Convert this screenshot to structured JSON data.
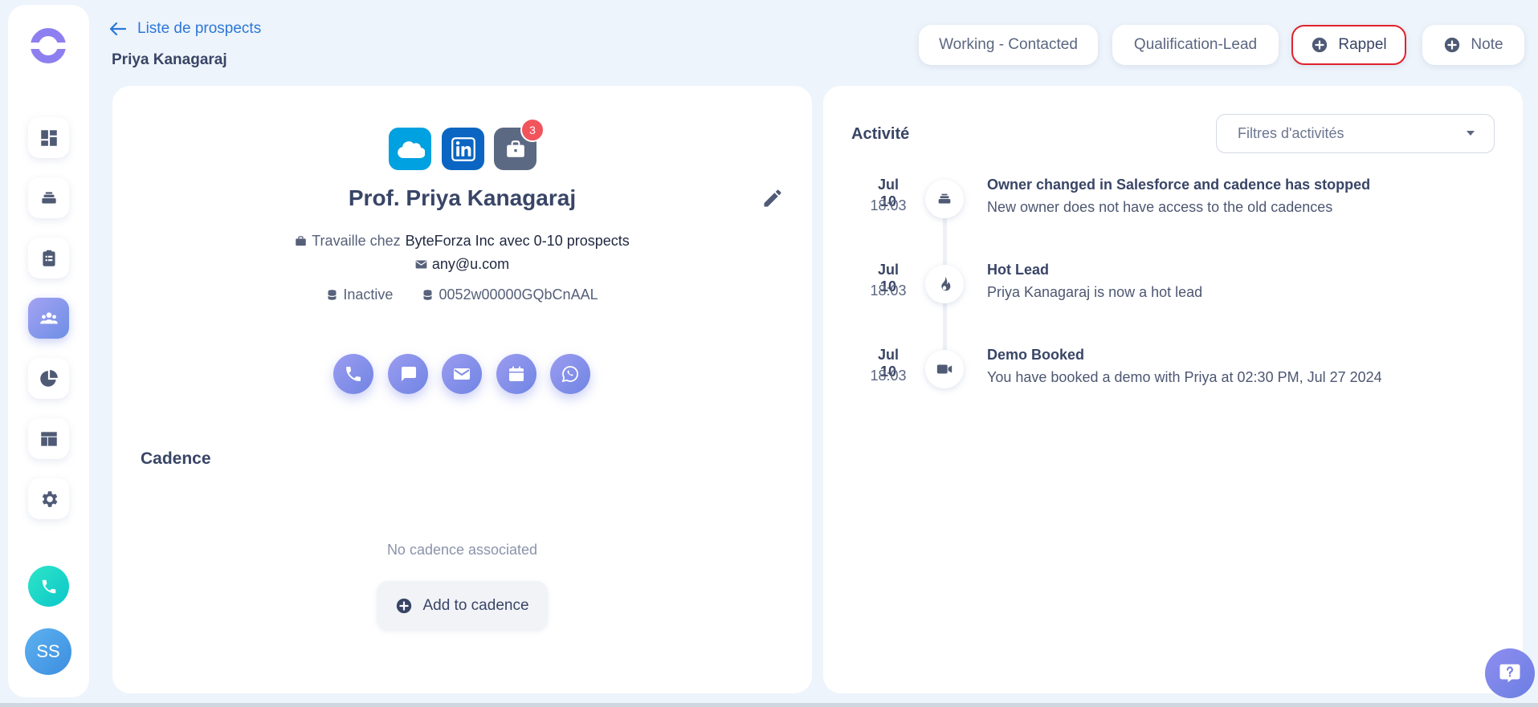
{
  "header": {
    "back_label": "Liste de prospects",
    "page_title": "Priya Kanagaraj",
    "status_button": "Working - Contacted",
    "stage_button": "Qualification-Lead",
    "reminder_button": "Rappel",
    "note_button": "Note"
  },
  "sidebar": {
    "items": [
      {
        "name": "dashboard"
      },
      {
        "name": "layers"
      },
      {
        "name": "tasks"
      },
      {
        "name": "leads",
        "active": true
      },
      {
        "name": "reports"
      },
      {
        "name": "templates"
      },
      {
        "name": "settings"
      }
    ],
    "avatar_initials": "SS"
  },
  "lead": {
    "name": "Prof. Priya Kanagaraj",
    "integration_badge_count": "3",
    "works_at_prefix": "Travaille chez",
    "company": "ByteForza Inc",
    "company_size": "avec 0-10 prospects",
    "email": "any@u.com",
    "status": "Inactive",
    "salesforce_id": "0052w00000GQbCnAAL"
  },
  "cadence": {
    "title": "Cadence",
    "empty_text": "No cadence associated",
    "add_button": "Add to cadence"
  },
  "activity": {
    "title": "Activité",
    "filter_placeholder": "Filtres d'activités",
    "items": [
      {
        "date": "Jul 10",
        "time": "18:03",
        "icon": "layers-icon",
        "title": "Owner changed in Salesforce and cadence has stopped",
        "description": "New owner does not have access to the old cadences"
      },
      {
        "date": "Jul 10",
        "time": "18:03",
        "icon": "fire-icon",
        "title": "Hot Lead",
        "description": "Priya Kanagaraj is now a hot lead"
      },
      {
        "date": "Jul 10",
        "time": "18:03",
        "icon": "video-icon",
        "title": "Demo Booked",
        "description": "You have booked a demo with Priya at 02:30 PM, Jul 27 2024"
      }
    ]
  },
  "colors": {
    "accent": "#2b77d8",
    "primary_gradient_start": "#9b9cf0",
    "primary_gradient_end": "#7085e3",
    "badge": "#f2545b",
    "rappel_border": "#e0222d"
  }
}
